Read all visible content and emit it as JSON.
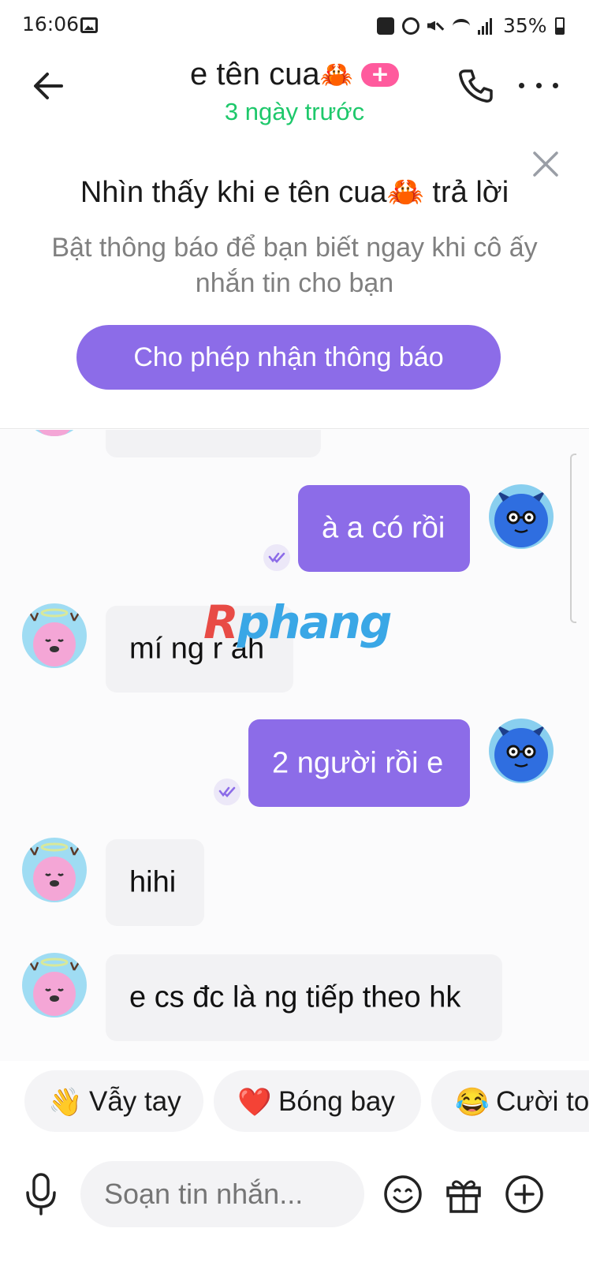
{
  "status_bar": {
    "time": "16:06",
    "battery": "35%"
  },
  "header": {
    "contact_name": "e tên cua",
    "contact_emoji": "🦀",
    "badge": "+",
    "last_seen": "3 ngày trước"
  },
  "banner": {
    "title": "Nhìn thấy khi e tên cua",
    "title_emoji": "🦀",
    "title_suffix": " trả lời",
    "description": "Bật thông báo để bạn biết ngay khi cô ấy nhắn tin cho bạn",
    "button": "Cho phép nhận thông báo"
  },
  "messages": [
    {
      "direction": "out",
      "text": "à a có rồi"
    },
    {
      "direction": "in",
      "text": "mí ng r ah"
    },
    {
      "direction": "out",
      "text": "2 người rồi e"
    },
    {
      "direction": "in",
      "text": "hihi"
    },
    {
      "direction": "in",
      "text": "e cs đc là ng tiếp theo hk"
    }
  ],
  "watermark": {
    "first": "R",
    "rest": "phang"
  },
  "quick_reactions": [
    {
      "emoji": "👋",
      "label": "Vẫy tay"
    },
    {
      "emoji": "❤️",
      "label": "Bóng bay"
    },
    {
      "emoji": "😂",
      "label": "Cười to"
    }
  ],
  "composer": {
    "placeholder": "Soạn tin nhắn..."
  },
  "colors": {
    "accent": "#8c6ce8",
    "online_green": "#1ec86b",
    "badge_pink": "#ff5a9d"
  }
}
